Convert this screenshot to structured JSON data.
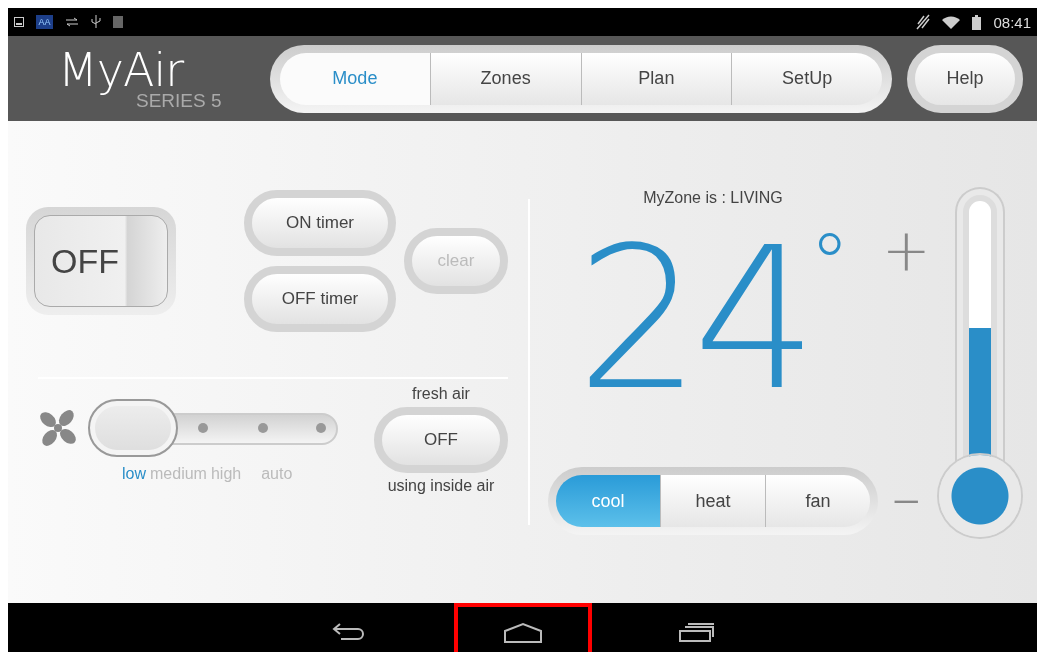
{
  "status_bar": {
    "aa_label": "AA",
    "time": "08:41"
  },
  "header": {
    "logo": "MyAir",
    "logo_sub": "SERIES 5",
    "tabs": [
      {
        "label": "Mode",
        "selected": true
      },
      {
        "label": "Zones",
        "selected": false
      },
      {
        "label": "Plan",
        "selected": false
      },
      {
        "label": "SetUp",
        "selected": false
      }
    ],
    "help": "Help"
  },
  "power": {
    "label": "OFF"
  },
  "timers": [
    {
      "label": "ON timer",
      "disabled": false
    },
    {
      "label": "OFF timer",
      "disabled": false
    }
  ],
  "clear": {
    "label": "clear",
    "disabled": true
  },
  "fan_speeds": [
    {
      "label": "low",
      "selected": true
    },
    {
      "label": "medium",
      "selected": false
    },
    {
      "label": "high",
      "selected": false
    },
    {
      "label": "auto",
      "selected": false
    }
  ],
  "fresh_air": {
    "title": "fresh air",
    "value": "OFF",
    "caption": "using inside air"
  },
  "zone": {
    "caption": "MyZone is : LIVING",
    "temperature": "24",
    "unit": "°",
    "plus": "+",
    "minus": "–",
    "level": 0.55
  },
  "modes": [
    {
      "label": "cool",
      "selected": true
    },
    {
      "label": "heat",
      "selected": false
    },
    {
      "label": "fan",
      "selected": false
    }
  ],
  "nav_keys": [
    {
      "kind": "back",
      "highlighted": false
    },
    {
      "kind": "home",
      "highlighted": true
    },
    {
      "kind": "recent",
      "highlighted": false
    }
  ]
}
